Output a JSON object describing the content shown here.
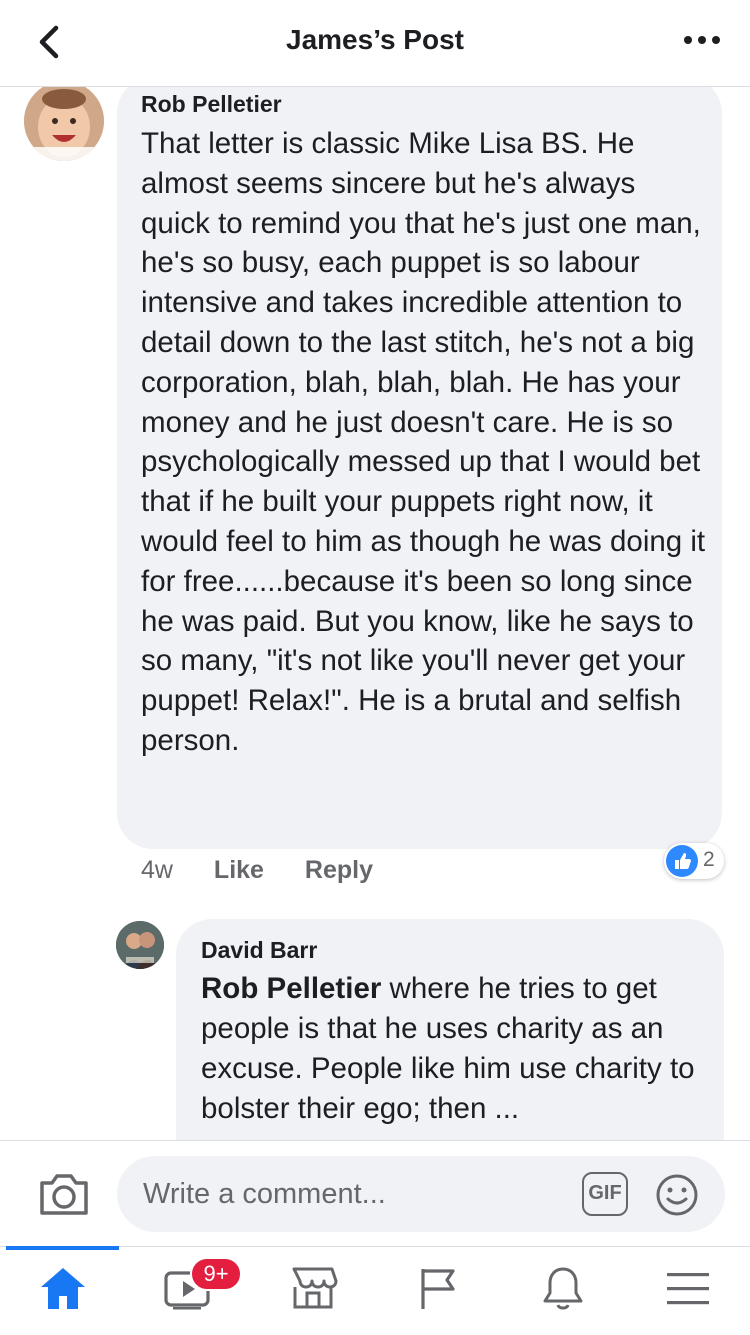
{
  "header": {
    "title": "James’s Post",
    "back_icon": "chevron-left-icon",
    "more_icon": "more-horizontal-icon"
  },
  "comments": [
    {
      "author": "Rob Pelletier",
      "text": "That letter is classic Mike Lisa BS. He almost seems sincere but he's always quick to remind you that he's just one man, he's so busy,  each puppet is so labour intensive and takes incredible attention to detail down to the last stitch, he's not a big corporation, blah, blah, blah. He has your money and he just doesn't care. He is so psychologically messed up that I would bet that if he built your puppets right now, it would feel to him as though he was doing it for free......because it's been so long since he was paid.  But you know, like he says to so many, \"it's not like you'll never get your puppet! Relax!\". He is a brutal and selfish person.",
      "age": "4w",
      "like_label": "Like",
      "reply_label": "Reply",
      "reaction_count": "2",
      "reaction_icon": "like-reaction-icon"
    },
    {
      "author": "David Barr",
      "mention": "Rob Pelletier",
      "text": " where he tries to get people is that he uses charity as an excuse. People like him use charity to bolster their ego; then ..."
    }
  ],
  "composer": {
    "placeholder": "Write a comment...",
    "gif_label": "GIF",
    "camera_icon": "camera-icon",
    "emoji_icon": "emoji-icon"
  },
  "tabbar": {
    "active_color": "#1877f2",
    "items": [
      {
        "name": "home",
        "icon": "home-icon"
      },
      {
        "name": "watch",
        "icon": "video-icon",
        "badge": "9+"
      },
      {
        "name": "marketplace",
        "icon": "marketplace-icon"
      },
      {
        "name": "pages",
        "icon": "flag-icon"
      },
      {
        "name": "notifications",
        "icon": "bell-icon"
      },
      {
        "name": "menu",
        "icon": "menu-icon"
      }
    ]
  }
}
